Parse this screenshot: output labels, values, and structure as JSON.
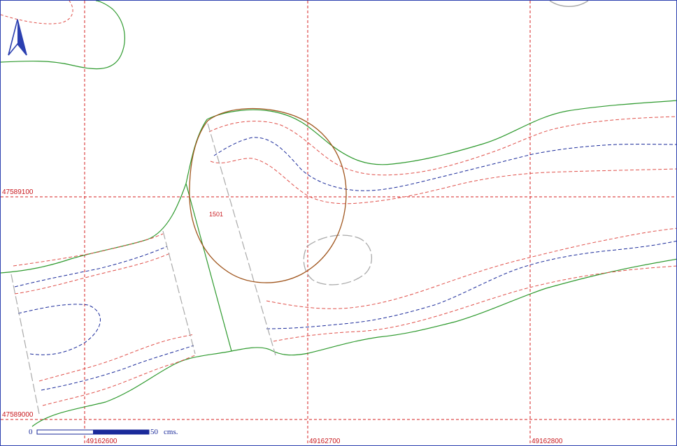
{
  "map": {
    "grid_color": "#d62020",
    "grid_x_labels": [
      "49162600",
      "49162700",
      "49162800"
    ],
    "grid_y_labels": [
      "47589100",
      "47589000"
    ],
    "feature_label": "1501",
    "north_arrow_icon": "north-arrow-icon",
    "colors": {
      "bank_line": "#2e9a2e",
      "contour_red": "#e0504a",
      "centerline_blue": "#1a2a9a",
      "gray_line": "#aaaaaa",
      "circle_brown": "#a0561e",
      "border": "#2b3fb0"
    }
  },
  "scale_bar": {
    "start_label": "0",
    "end_label": "50",
    "unit": "cms."
  }
}
